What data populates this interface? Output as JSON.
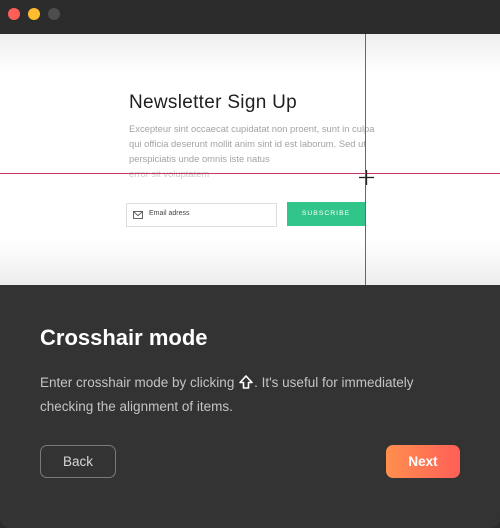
{
  "window": {
    "controls": [
      "close",
      "minimize",
      "maximize"
    ]
  },
  "preview": {
    "title": "Newsletter Sign Up",
    "body": "Excepteur sint occaecat cupidatat non proent, sunt in culpa qui officia deserunt mollit anim sint id est laborum. Sed ut perspiciatis unde omnis iste natus",
    "body_faded": "error sit voluptatem",
    "email_placeholder": "Email adress",
    "subscribe_label": "SUBSCRIBE",
    "accent_color": "#32c58a",
    "crosshair_color": "#c9395f"
  },
  "tutorial": {
    "heading": "Crosshair mode",
    "text_before": "Enter crosshair mode by clicking",
    "icon": "shift-arrow-icon",
    "text_after": ". It's useful for immediately checking the alignment of items.",
    "back_label": "Back",
    "next_label": "Next",
    "next_gradient": [
      "#ff8f4e",
      "#ff5f57"
    ]
  }
}
